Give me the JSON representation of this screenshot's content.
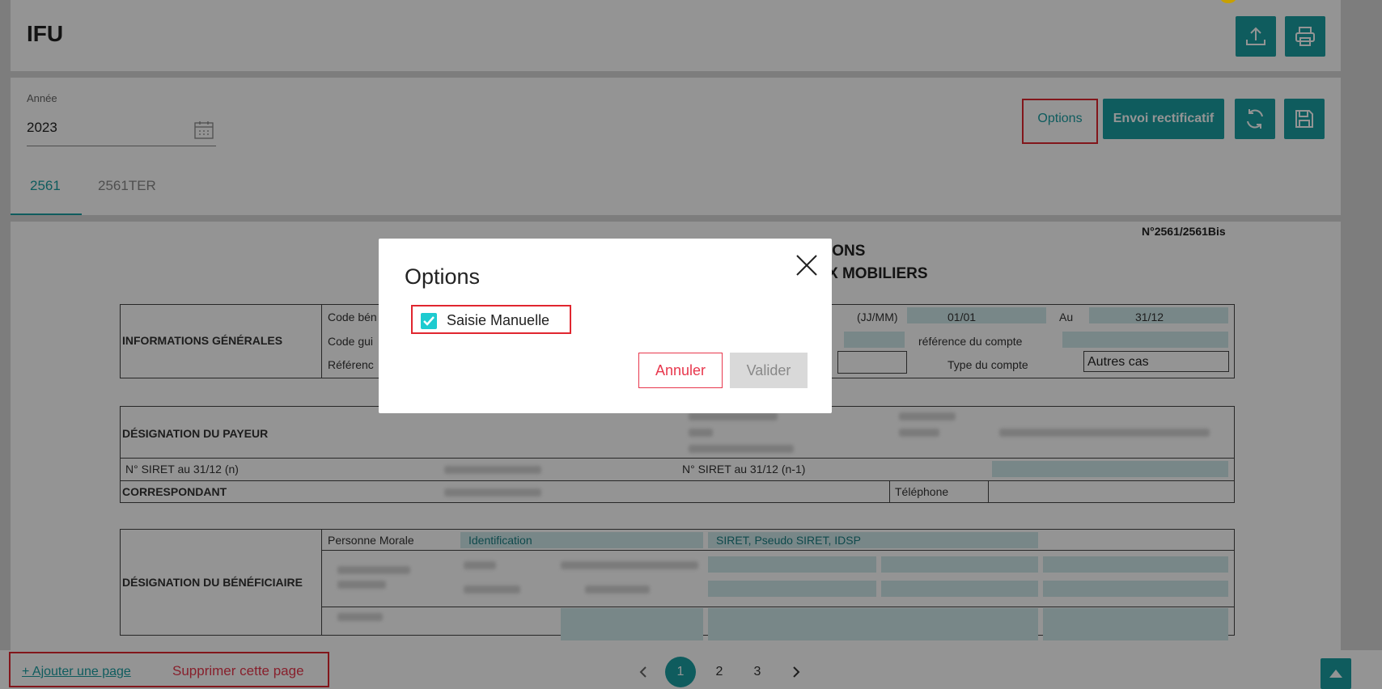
{
  "header": {
    "title": "IFU"
  },
  "filters": {
    "year_label": "Année",
    "year_value": "2023",
    "options_label": "Options",
    "envoi_label": "Envoi rectificatif"
  },
  "tabs": [
    {
      "label": "2561"
    },
    {
      "label": "2561TER"
    }
  ],
  "document": {
    "form_number": "N°2561/2561Bis",
    "heading_line1": "IONS",
    "heading_line2": "X MOBILIERS",
    "info": {
      "section_label": "INFORMATIONS GÉNÉRALES",
      "code_ben": "Code bén",
      "code_gui": "Code gui",
      "reference": "Référenc",
      "jjmm": "(JJ/MM)",
      "date_from": "01/01",
      "au": "Au",
      "date_to": "31/12",
      "ref_compte": "référence du compte",
      "type_compte": "Type du compte",
      "type_compte_value": "Autres cas"
    },
    "payeur": {
      "section_label": "DÉSIGNATION DU PAYEUR",
      "siret_n": "N° SIRET au 31/12 (n)",
      "siret_n1": "N° SIRET au 31/12 (n-1)",
      "correspondant": "CORRESPONDANT",
      "telephone": "Téléphone"
    },
    "beneficiaire": {
      "section_label": "DÉSIGNATION DU BÉNÉFICIAIRE",
      "personne_morale": "Personne Morale",
      "identification": "Identification",
      "siret_pseudo": "SIRET, Pseudo SIRET, IDSP"
    }
  },
  "footer": {
    "add_page": "+ Ajouter une page",
    "delete_page": "Supprimer cette page",
    "pages": [
      "1",
      "2",
      "3"
    ],
    "current_page": "1"
  },
  "modal": {
    "title": "Options",
    "checkbox_label": "Saisie Manuelle",
    "checkbox_checked": true,
    "cancel_label": "Annuler",
    "validate_label": "Valider"
  },
  "colors": {
    "accent": "#1a9fa3",
    "danger": "#e0262f",
    "cancel_text": "#e8374d"
  }
}
